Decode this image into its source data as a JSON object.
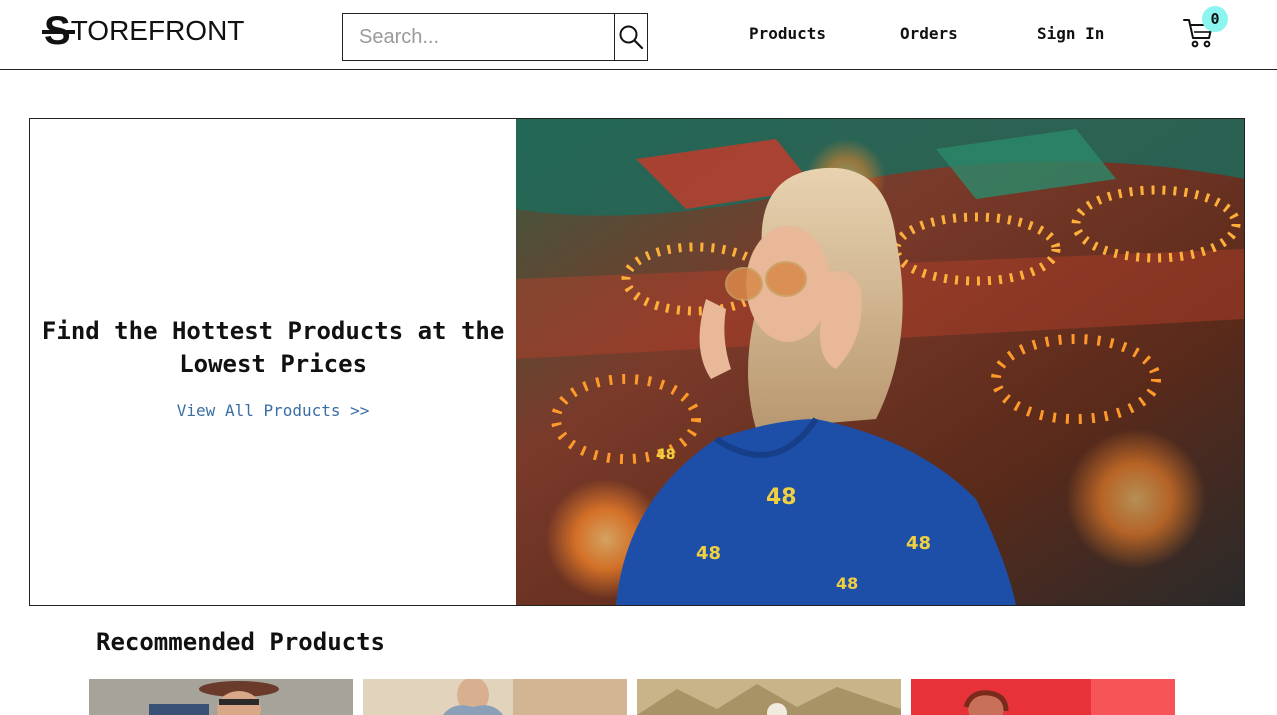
{
  "header": {
    "logo_letter": "S",
    "logo_text": "TOREFRONT",
    "search": {
      "placeholder": "Search...",
      "value": ""
    },
    "nav": {
      "products": "Products",
      "orders": "Orders",
      "sign_in": "Sign In"
    },
    "cart": {
      "count": "0",
      "badge_color": "#8cf5f0"
    }
  },
  "hero": {
    "title": "Find the Hottest Products at the Lowest Prices",
    "link": "View All Products >>",
    "link_color": "#3a6ea5",
    "image_icon": "fashion-photo"
  },
  "recommended": {
    "title": "Recommended Products",
    "products": [
      {
        "image_icon": "product-photo-1"
      },
      {
        "image_icon": "product-photo-2"
      },
      {
        "image_icon": "product-photo-3"
      },
      {
        "image_icon": "product-photo-4"
      }
    ]
  }
}
